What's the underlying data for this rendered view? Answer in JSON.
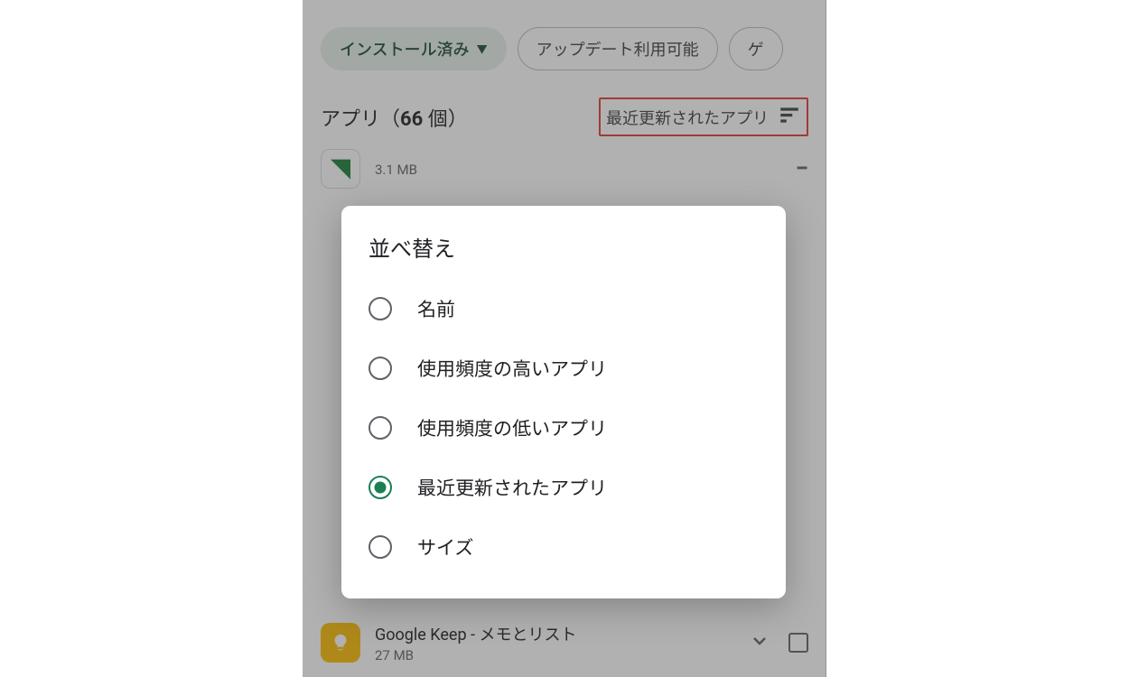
{
  "chips": {
    "installed": "インストール済み",
    "updates": "アップデート利用可能",
    "games_cut": "ゲ"
  },
  "header": {
    "title_prefix": "アプリ（",
    "count": "66",
    "title_suffix": " 個）",
    "sort_current": "最近更新されたアプリ"
  },
  "apps": {
    "top_size": "3.1 MB",
    "keep_name": "Google Keep - メモとリスト",
    "keep_size": "27 MB"
  },
  "dialog": {
    "title": "並べ替え",
    "options": [
      {
        "label": "名前",
        "selected": false
      },
      {
        "label": "使用頻度の高いアプリ",
        "selected": false
      },
      {
        "label": "使用頻度の低いアプリ",
        "selected": false
      },
      {
        "label": "最近更新されたアプリ",
        "selected": true
      },
      {
        "label": "サイズ",
        "selected": false
      }
    ]
  }
}
